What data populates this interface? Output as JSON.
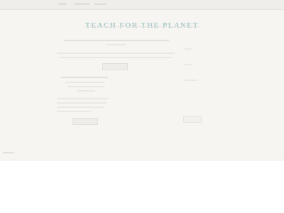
{
  "nav": {
    "items": [
      {
        "label": "Home"
      },
      {
        "label": "Teachers"
      },
      {
        "label": "Sign Up"
      }
    ]
  },
  "header": {
    "title": "TEACH FOR THE PLANET"
  },
  "colors": {
    "title": "#a9c9c9",
    "page_background": "#f6f5f2",
    "nav_background": "#f0eeea"
  }
}
